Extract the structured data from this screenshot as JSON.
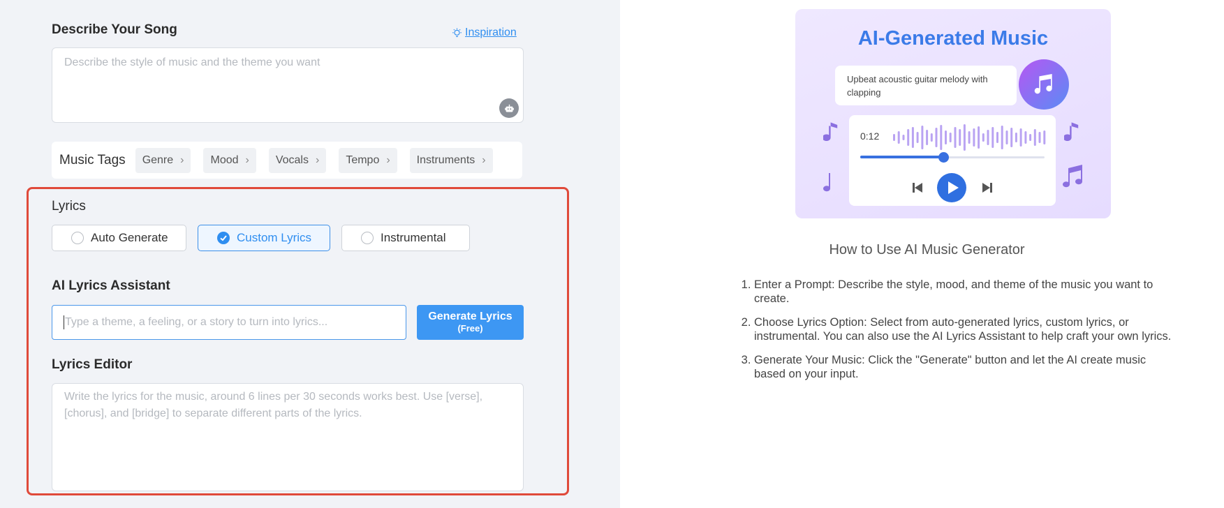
{
  "describe": {
    "title": "Describe Your Song",
    "inspiration_label": "Inspiration",
    "placeholder": "Describe the style of music and the theme you want",
    "robot_icon": "robot-icon"
  },
  "music_tags": {
    "label": "Music Tags",
    "items": [
      "Genre",
      "Mood",
      "Vocals",
      "Tempo",
      "Instruments"
    ]
  },
  "lyrics": {
    "title": "Lyrics",
    "options": [
      {
        "label": "Auto Generate",
        "selected": false
      },
      {
        "label": "Custom Lyrics",
        "selected": true
      },
      {
        "label": "Instrumental",
        "selected": false
      }
    ]
  },
  "assistant": {
    "title": "AI Lyrics Assistant",
    "placeholder": "Type a theme, a feeling, or a story to turn into lyrics...",
    "button_label": "Generate Lyrics",
    "button_sub": "(Free)"
  },
  "editor": {
    "title": "Lyrics Editor",
    "placeholder": "Write the lyrics for the music, around 6 lines per 30 seconds works best. Use [verse], [chorus], and [bridge] to separate different parts of the lyrics."
  },
  "promo": {
    "title": "AI-Generated Music",
    "prompt_text": "Upbeat acoustic guitar melody with clapping",
    "time": "0:12",
    "progress": 0.45
  },
  "howto": {
    "title": "How to Use AI Music Generator",
    "steps": [
      "Enter a Prompt: Describe the style, mood, and theme of the music you want to create.",
      "Choose Lyrics Option: Select from auto-generated lyrics, custom lyrics, or instrumental. You can also use the AI Lyrics Assistant to help craft your own lyrics.",
      "Generate Your Music: Click the \"Generate\" button and let the AI create music based on your input."
    ]
  },
  "colors": {
    "accent": "#2f8ef0",
    "highlight_border": "#e04a3a",
    "panel_bg": "#f1f3f7"
  }
}
